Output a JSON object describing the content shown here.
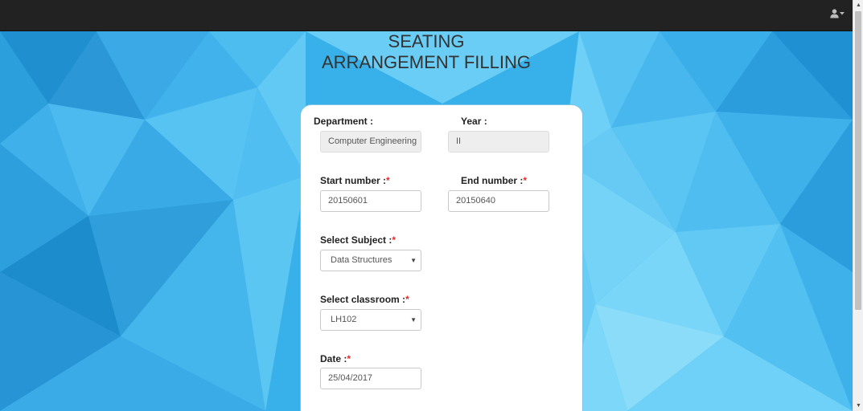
{
  "navbar": {
    "user_icon": "user-icon",
    "dropdown_icon": "caret-down-icon"
  },
  "page": {
    "title_line1": "SEATING",
    "title_line2": "ARRANGEMENT FILLING"
  },
  "form": {
    "department": {
      "label": "Department :",
      "value": "Computer Engineering"
    },
    "year": {
      "label": "Year :",
      "value": "II"
    },
    "start_number": {
      "label": "Start number :",
      "required": "*",
      "value": "20150601"
    },
    "end_number": {
      "label": "End number :",
      "required": "*",
      "value": "20150640"
    },
    "subject": {
      "label": "Select Subject :",
      "required": "*",
      "selected": "Data Structures"
    },
    "classroom": {
      "label": "Select classroom :",
      "required": "*",
      "selected": "LH102"
    },
    "date": {
      "label": "Date :",
      "required": "*",
      "value": "25/04/2017"
    }
  },
  "colors": {
    "navbar": "#222222",
    "background": "#39b4ec",
    "required_marker": "#e52b2b",
    "card_border": "#7cc3e8"
  }
}
